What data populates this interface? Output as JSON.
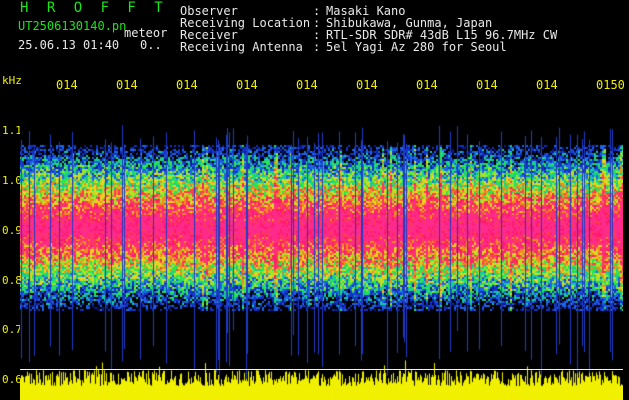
{
  "header": {
    "app_title": "H R O F F T",
    "filename": "UT2506130140.pn",
    "tag": "meteor",
    "datetime": "25.06.13 01:40",
    "extra": "0.."
  },
  "info": [
    {
      "label": "Observer",
      "value": "Masaki Kano"
    },
    {
      "label": "Receiving Location",
      "value": "Shibukawa, Gunma, Japan"
    },
    {
      "label": "Receiver",
      "value": "RTL-SDR SDR# 43dB L15 96.7MHz CW"
    },
    {
      "label": "Receiving Antenna",
      "value": "5el Yagi Az 280 for Seoul"
    }
  ],
  "colon": ":",
  "axis": {
    "y_unit": "kHz",
    "y_ticks": [
      "1.1",
      "1.0",
      "0.9",
      "0.8",
      "0.7",
      "0.6"
    ],
    "x_ticks": [
      "014",
      "014",
      "014",
      "014",
      "014",
      "014",
      "014",
      "014",
      "014",
      "0150"
    ]
  },
  "colors": {
    "label_green": "#19e619",
    "axis_yellow": "#f0f000",
    "signal_core": "#ff1a6e",
    "signal_mid": "#16c8a0",
    "signal_edge": "#1432c8"
  }
}
